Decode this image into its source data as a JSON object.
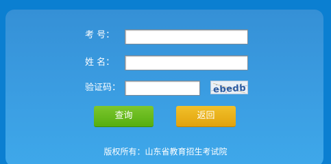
{
  "form": {
    "exam_number_label": "考 号：",
    "name_label": "姓 名：",
    "captcha_label": "验证码：",
    "exam_number_value": "",
    "name_value": "",
    "captcha_value": "",
    "captcha_text": "ebedb"
  },
  "buttons": {
    "query_label": "查询",
    "back_label": "返回"
  },
  "footer": {
    "copyright": "版权所有：山东省教育招生考试院"
  },
  "colors": {
    "page_background": "#0b7fd1",
    "panel_background": "#3a9be0",
    "query_button": "#62b81c",
    "back_button": "#e8b01c"
  }
}
